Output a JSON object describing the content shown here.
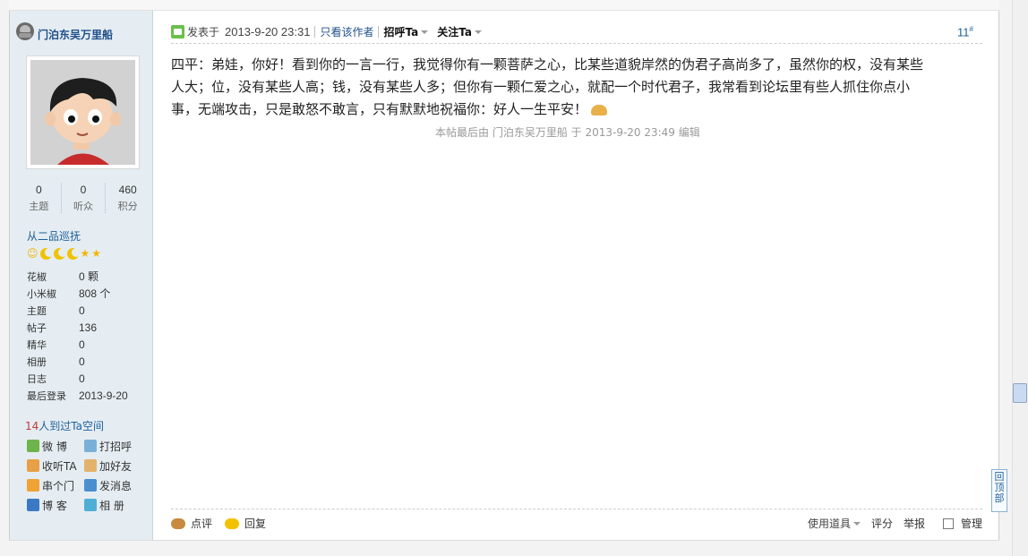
{
  "author": {
    "name": "门泊东吴万里船"
  },
  "stats": [
    {
      "value": "0",
      "label": "主题"
    },
    {
      "value": "0",
      "label": "听众"
    },
    {
      "value": "460",
      "label": "积分"
    }
  ],
  "rank": {
    "title": "从二品巡抚"
  },
  "info": [
    {
      "key": "花椒",
      "value": "0 颗"
    },
    {
      "key": "小米椒",
      "value": "808 个"
    },
    {
      "key": "主题",
      "value": "0"
    },
    {
      "key": "帖子",
      "value": "136"
    },
    {
      "key": "精华",
      "value": "0"
    },
    {
      "key": "相册",
      "value": "0"
    },
    {
      "key": "日志",
      "value": "0"
    },
    {
      "key": "最后登录",
      "value": "2013-9-20"
    }
  ],
  "visitors": {
    "count": "14",
    "text": "人到过Ta空间"
  },
  "actions": [
    {
      "label": "微 博"
    },
    {
      "label": "打招呼"
    },
    {
      "label": "收听TA"
    },
    {
      "label": "加好友"
    },
    {
      "label": "串个门"
    },
    {
      "label": "发消息"
    },
    {
      "label": "博 客"
    },
    {
      "label": "相 册"
    }
  ],
  "post": {
    "posted_label": "发表于",
    "date": "2013-9-20 23:31",
    "only_author": "只看该作者",
    "greet": "招呼Ta",
    "follow": "关注Ta",
    "floor": "11",
    "floor_mark": "#",
    "body_line1": "四平：弟娃，你好！看到你的一言一行，我觉得你有一颗菩萨之心，比某些道貌岸然的伪君子高尚多了，虽然你的权，没有某些",
    "body_line2": "人大；位，没有某些人高；钱，没有某些人多；但你有一颗仁爱之心，就配一个时代君子，我常看到论坛里有些人抓住你点小",
    "body_line3": "事，无端攻击，只是敢怒不敢言，只有默默地祝福你：好人一生平安！",
    "edit_note": "本帖最后由 门泊东吴万里船 于 2013-9-20 23:49 编辑"
  },
  "footer": {
    "rate": "点评",
    "reply": "回复",
    "tools": "使用道具",
    "score": "评分",
    "report": "举报",
    "manage": "管理"
  },
  "back_to_top": "回顶部"
}
